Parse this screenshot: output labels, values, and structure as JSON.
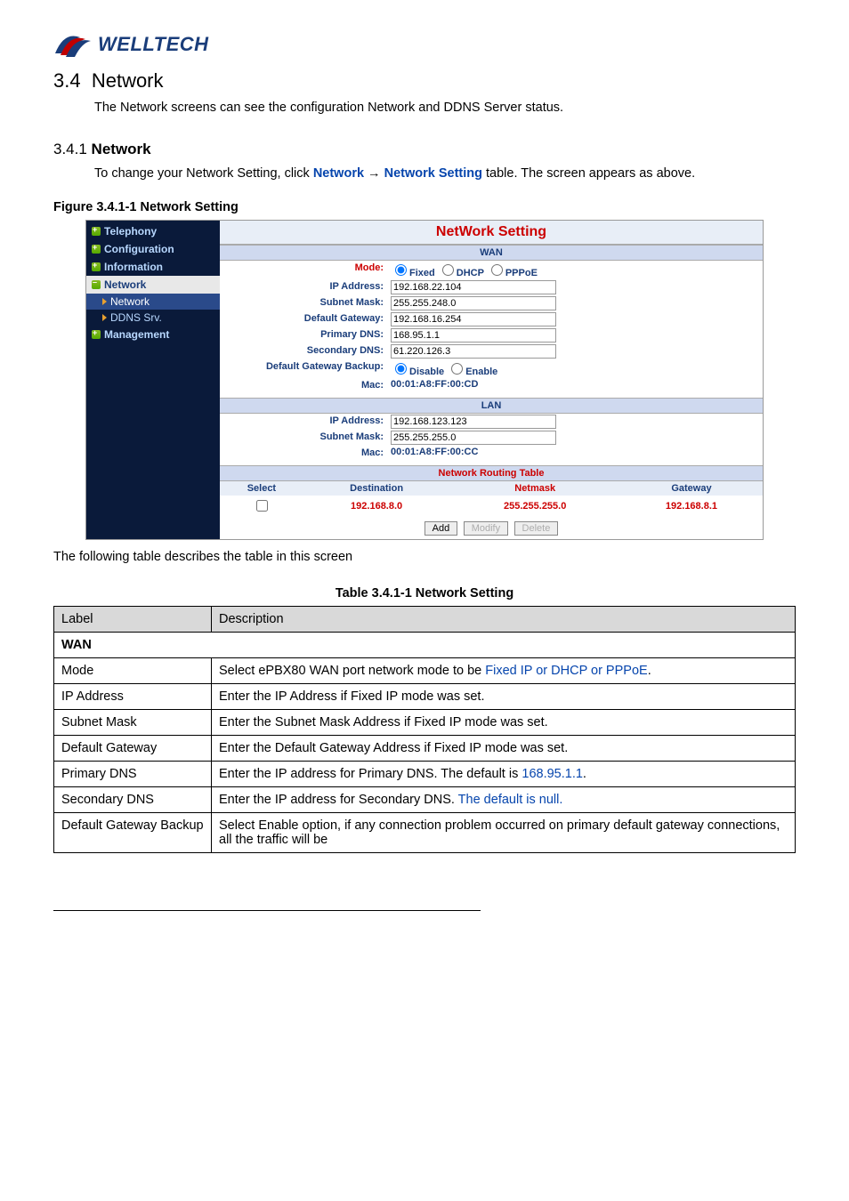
{
  "logo": {
    "text": "WELLTECH"
  },
  "h1": {
    "num": "3.4",
    "title": "Network"
  },
  "p1": "The Network screens can see the configuration Network and DDNS Server status.",
  "h2": {
    "num": "3.4.1",
    "title": "Network"
  },
  "p2a": "To change your Network Setting, click ",
  "p2link1": "Network",
  "p2arrow": " → ",
  "p2link2": "Network Setting",
  "p2b": " table. The screen appears as above.",
  "fig_title": "Figure   3.4.1-1 Network Setting",
  "sidebar": {
    "items": [
      {
        "label": "Telephony",
        "type": "top"
      },
      {
        "label": "Configuration",
        "type": "top"
      },
      {
        "label": "Information",
        "type": "top"
      },
      {
        "label": "Network",
        "type": "sel"
      },
      {
        "label": "Network",
        "type": "sub",
        "active": true
      },
      {
        "label": "DDNS Srv.",
        "type": "sub"
      },
      {
        "label": "Management",
        "type": "top"
      }
    ]
  },
  "network_setting": {
    "title": "NetWork Setting",
    "wan": {
      "header": "WAN",
      "mode_label": "Mode:",
      "mode_opts": [
        "Fixed",
        "DHCP",
        "PPPoE"
      ],
      "ip_label": "IP Address:",
      "ip": "192.168.22.104",
      "mask_label": "Subnet Mask:",
      "mask": "255.255.248.0",
      "gw_label": "Default Gateway:",
      "gw": "192.168.16.254",
      "pdns_label": "Primary DNS:",
      "pdns": "168.95.1.1",
      "sdns_label": "Secondary DNS:",
      "sdns": "61.220.126.3",
      "gwbk_label": "Default Gateway Backup:",
      "gwbk_opts": [
        "Disable",
        "Enable"
      ],
      "mac_label": "Mac:",
      "mac": "00:01:A8:FF:00:CD"
    },
    "lan": {
      "header": "LAN",
      "ip_label": "IP Address:",
      "ip": "192.168.123.123",
      "mask_label": "Subnet Mask:",
      "mask": "255.255.255.0",
      "mac_label": "Mac:",
      "mac": "00:01:A8:FF:00:CC"
    },
    "routing": {
      "header": "Network Routing Table",
      "cols": [
        "Select",
        "Destination",
        "Netmask",
        "Gateway"
      ],
      "rows": [
        {
          "dest": "192.168.8.0",
          "mask": "255.255.255.0",
          "gw": "192.168.8.1"
        }
      ],
      "buttons": [
        "Add",
        "Modify",
        "Delete"
      ]
    }
  },
  "following": "The following table describes the table in this screen",
  "table_caption": "Table 3.4.1-1 Network Setting",
  "desc": {
    "hdr": [
      "Label",
      "Description"
    ],
    "wan": "WAN",
    "rows": [
      {
        "l": "Mode",
        "d_pre": "Select ePBX80 WAN port network mode to be ",
        "d_link": "Fixed IP or DHCP or PPPoE",
        "d_post": "."
      },
      {
        "l": "IP Address",
        "d": "Enter the IP Address if Fixed IP mode was set."
      },
      {
        "l": "Subnet Mask",
        "d": "Enter the Subnet Mask Address if Fixed IP mode was set."
      },
      {
        "l": "Default Gateway",
        "d": "Enter the Default Gateway Address if Fixed IP mode was set."
      },
      {
        "l": "Primary DNS",
        "d_pre": "Enter  the  IP  address  for  Primary  DNS.  The  default  is ",
        "d_link": "168.95.1.1",
        "d_post": "."
      },
      {
        "l": "Secondary DNS",
        "d_pre": "Enter the IP address for Secondary DNS. ",
        "d_link": "The default is null.",
        "d_post": ""
      },
      {
        "l": "Default Gateway Backup",
        "d": "Select Enable option, if any connection problem occurred on primary  default  gateway  connections,  all  the  traffic  will  be"
      }
    ]
  }
}
